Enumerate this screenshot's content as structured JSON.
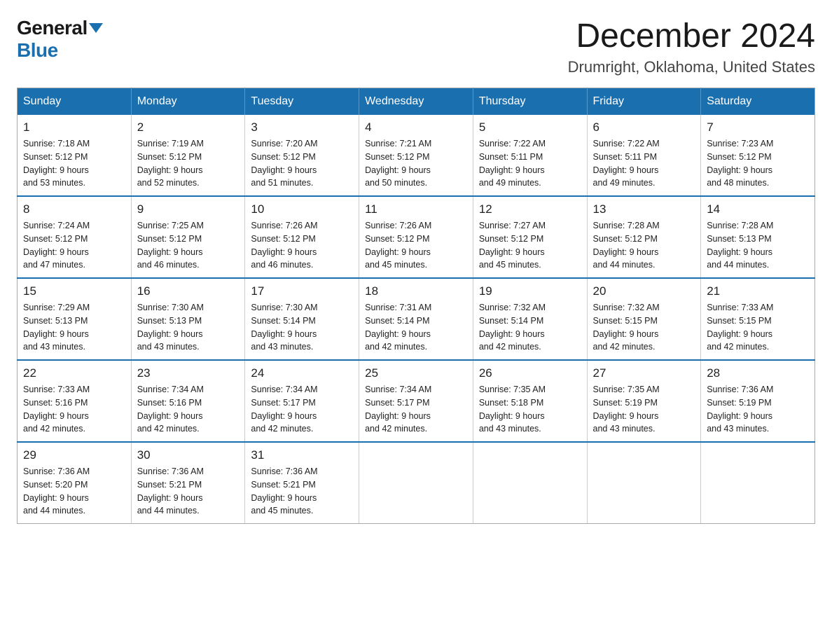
{
  "logo": {
    "general": "General",
    "blue": "Blue"
  },
  "header": {
    "month_title": "December 2024",
    "location": "Drumright, Oklahoma, United States"
  },
  "weekdays": [
    "Sunday",
    "Monday",
    "Tuesday",
    "Wednesday",
    "Thursday",
    "Friday",
    "Saturday"
  ],
  "weeks": [
    [
      {
        "day": "1",
        "sunrise": "7:18 AM",
        "sunset": "5:12 PM",
        "daylight": "9 hours and 53 minutes."
      },
      {
        "day": "2",
        "sunrise": "7:19 AM",
        "sunset": "5:12 PM",
        "daylight": "9 hours and 52 minutes."
      },
      {
        "day": "3",
        "sunrise": "7:20 AM",
        "sunset": "5:12 PM",
        "daylight": "9 hours and 51 minutes."
      },
      {
        "day": "4",
        "sunrise": "7:21 AM",
        "sunset": "5:12 PM",
        "daylight": "9 hours and 50 minutes."
      },
      {
        "day": "5",
        "sunrise": "7:22 AM",
        "sunset": "5:11 PM",
        "daylight": "9 hours and 49 minutes."
      },
      {
        "day": "6",
        "sunrise": "7:22 AM",
        "sunset": "5:11 PM",
        "daylight": "9 hours and 49 minutes."
      },
      {
        "day": "7",
        "sunrise": "7:23 AM",
        "sunset": "5:12 PM",
        "daylight": "9 hours and 48 minutes."
      }
    ],
    [
      {
        "day": "8",
        "sunrise": "7:24 AM",
        "sunset": "5:12 PM",
        "daylight": "9 hours and 47 minutes."
      },
      {
        "day": "9",
        "sunrise": "7:25 AM",
        "sunset": "5:12 PM",
        "daylight": "9 hours and 46 minutes."
      },
      {
        "day": "10",
        "sunrise": "7:26 AM",
        "sunset": "5:12 PM",
        "daylight": "9 hours and 46 minutes."
      },
      {
        "day": "11",
        "sunrise": "7:26 AM",
        "sunset": "5:12 PM",
        "daylight": "9 hours and 45 minutes."
      },
      {
        "day": "12",
        "sunrise": "7:27 AM",
        "sunset": "5:12 PM",
        "daylight": "9 hours and 45 minutes."
      },
      {
        "day": "13",
        "sunrise": "7:28 AM",
        "sunset": "5:12 PM",
        "daylight": "9 hours and 44 minutes."
      },
      {
        "day": "14",
        "sunrise": "7:28 AM",
        "sunset": "5:13 PM",
        "daylight": "9 hours and 44 minutes."
      }
    ],
    [
      {
        "day": "15",
        "sunrise": "7:29 AM",
        "sunset": "5:13 PM",
        "daylight": "9 hours and 43 minutes."
      },
      {
        "day": "16",
        "sunrise": "7:30 AM",
        "sunset": "5:13 PM",
        "daylight": "9 hours and 43 minutes."
      },
      {
        "day": "17",
        "sunrise": "7:30 AM",
        "sunset": "5:14 PM",
        "daylight": "9 hours and 43 minutes."
      },
      {
        "day": "18",
        "sunrise": "7:31 AM",
        "sunset": "5:14 PM",
        "daylight": "9 hours and 42 minutes."
      },
      {
        "day": "19",
        "sunrise": "7:32 AM",
        "sunset": "5:14 PM",
        "daylight": "9 hours and 42 minutes."
      },
      {
        "day": "20",
        "sunrise": "7:32 AM",
        "sunset": "5:15 PM",
        "daylight": "9 hours and 42 minutes."
      },
      {
        "day": "21",
        "sunrise": "7:33 AM",
        "sunset": "5:15 PM",
        "daylight": "9 hours and 42 minutes."
      }
    ],
    [
      {
        "day": "22",
        "sunrise": "7:33 AM",
        "sunset": "5:16 PM",
        "daylight": "9 hours and 42 minutes."
      },
      {
        "day": "23",
        "sunrise": "7:34 AM",
        "sunset": "5:16 PM",
        "daylight": "9 hours and 42 minutes."
      },
      {
        "day": "24",
        "sunrise": "7:34 AM",
        "sunset": "5:17 PM",
        "daylight": "9 hours and 42 minutes."
      },
      {
        "day": "25",
        "sunrise": "7:34 AM",
        "sunset": "5:17 PM",
        "daylight": "9 hours and 42 minutes."
      },
      {
        "day": "26",
        "sunrise": "7:35 AM",
        "sunset": "5:18 PM",
        "daylight": "9 hours and 43 minutes."
      },
      {
        "day": "27",
        "sunrise": "7:35 AM",
        "sunset": "5:19 PM",
        "daylight": "9 hours and 43 minutes."
      },
      {
        "day": "28",
        "sunrise": "7:36 AM",
        "sunset": "5:19 PM",
        "daylight": "9 hours and 43 minutes."
      }
    ],
    [
      {
        "day": "29",
        "sunrise": "7:36 AM",
        "sunset": "5:20 PM",
        "daylight": "9 hours and 44 minutes."
      },
      {
        "day": "30",
        "sunrise": "7:36 AM",
        "sunset": "5:21 PM",
        "daylight": "9 hours and 44 minutes."
      },
      {
        "day": "31",
        "sunrise": "7:36 AM",
        "sunset": "5:21 PM",
        "daylight": "9 hours and 45 minutes."
      },
      null,
      null,
      null,
      null
    ]
  ]
}
